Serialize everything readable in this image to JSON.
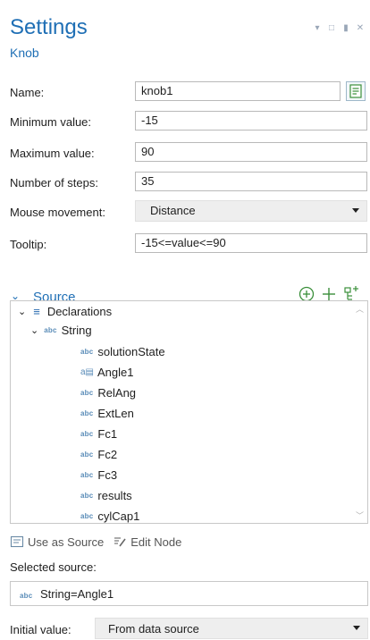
{
  "header": {
    "title": "Settings",
    "subtitle": "Knob"
  },
  "window_controls": [
    "pin-icon",
    "restore-icon",
    "dock-icon",
    "close-icon"
  ],
  "fields": {
    "name": {
      "label": "Name:",
      "value": "knob1"
    },
    "minimum": {
      "label": "Minimum value:",
      "value": "-15"
    },
    "maximum": {
      "label": "Maximum value:",
      "value": "90"
    },
    "steps": {
      "label": "Number of steps:",
      "value": "35"
    },
    "mouse": {
      "label": "Mouse movement:",
      "value": "Distance"
    },
    "tooltip": {
      "label": "Tooltip:",
      "value": "-15<=value<=90"
    }
  },
  "source": {
    "title": "Source",
    "tree": {
      "root": "Declarations",
      "group": "String",
      "items": [
        "solutionState",
        "Angle1",
        "RelAng",
        "ExtLen",
        "Fc1",
        "Fc2",
        "Fc3",
        "results",
        "cylCap1"
      ]
    },
    "use_as_source": "Use as Source",
    "edit_node": "Edit Node",
    "selected_label": "Selected source:",
    "selected_value": "String=Angle1"
  },
  "initial": {
    "label": "Initial value:",
    "value": "From data source"
  },
  "colors": {
    "accent": "#1f6fb5",
    "green_icon": "#3a8f3a"
  }
}
